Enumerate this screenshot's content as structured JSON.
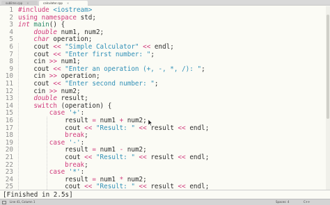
{
  "tabs": [
    {
      "label": "sublime.cpp",
      "active": false
    },
    {
      "label": "calculator.cpp",
      "active": true
    }
  ],
  "code_lines": [
    {
      "n": "1",
      "tokens": [
        {
          "t": "#include ",
          "c": "pp"
        },
        {
          "t": "<iostream>",
          "c": "str"
        }
      ]
    },
    {
      "n": "2",
      "tokens": [
        {
          "t": "using ",
          "c": "kw"
        },
        {
          "t": "namespace ",
          "c": "kw"
        },
        {
          "t": "std;",
          "c": "plain"
        }
      ]
    },
    {
      "n": "3",
      "tokens": [
        {
          "t": "int ",
          "c": "type"
        },
        {
          "t": "main",
          "c": "fn"
        },
        {
          "t": "() {",
          "c": "plain"
        }
      ]
    },
    {
      "n": "4",
      "tokens": [
        {
          "t": "    ",
          "c": "plain"
        },
        {
          "t": "double ",
          "c": "type"
        },
        {
          "t": "num1, num2;",
          "c": "plain"
        }
      ]
    },
    {
      "n": "5",
      "tokens": [
        {
          "t": "    ",
          "c": "plain"
        },
        {
          "t": "char ",
          "c": "type"
        },
        {
          "t": "operation;",
          "c": "plain"
        }
      ]
    },
    {
      "n": "6",
      "tokens": [
        {
          "t": "    cout ",
          "c": "plain"
        },
        {
          "t": "<< ",
          "c": "op"
        },
        {
          "t": "\"Simple Calculator\" ",
          "c": "str"
        },
        {
          "t": "<< ",
          "c": "op"
        },
        {
          "t": "endl;",
          "c": "plain"
        }
      ]
    },
    {
      "n": "7",
      "tokens": [
        {
          "t": "    cout ",
          "c": "plain"
        },
        {
          "t": "<< ",
          "c": "op"
        },
        {
          "t": "\"Enter first number: \"",
          "c": "str"
        },
        {
          "t": ";",
          "c": "plain"
        }
      ]
    },
    {
      "n": "8",
      "tokens": [
        {
          "t": "    cin ",
          "c": "plain"
        },
        {
          "t": ">> ",
          "c": "op"
        },
        {
          "t": "num1;",
          "c": "plain"
        }
      ]
    },
    {
      "n": "9",
      "tokens": [
        {
          "t": "    cout ",
          "c": "plain"
        },
        {
          "t": "<< ",
          "c": "op"
        },
        {
          "t": "\"Enter an operation (+, -, *, /): \"",
          "c": "str"
        },
        {
          "t": ";",
          "c": "plain"
        }
      ]
    },
    {
      "n": "10",
      "tokens": [
        {
          "t": "    cin ",
          "c": "plain"
        },
        {
          "t": ">> ",
          "c": "op"
        },
        {
          "t": "operation;",
          "c": "plain"
        }
      ]
    },
    {
      "n": "11",
      "tokens": [
        {
          "t": "    cout ",
          "c": "plain"
        },
        {
          "t": "<< ",
          "c": "op"
        },
        {
          "t": "\"Enter second number: \"",
          "c": "str"
        },
        {
          "t": ";",
          "c": "plain"
        }
      ]
    },
    {
      "n": "12",
      "tokens": [
        {
          "t": "    cin ",
          "c": "plain"
        },
        {
          "t": ">> ",
          "c": "op"
        },
        {
          "t": "num2;",
          "c": "plain"
        }
      ]
    },
    {
      "n": "13",
      "tokens": [
        {
          "t": "    ",
          "c": "plain"
        },
        {
          "t": "double ",
          "c": "type"
        },
        {
          "t": "result;",
          "c": "plain"
        }
      ]
    },
    {
      "n": "14",
      "tokens": [
        {
          "t": "    ",
          "c": "plain"
        },
        {
          "t": "switch ",
          "c": "kw"
        },
        {
          "t": "(operation) {",
          "c": "plain"
        }
      ]
    },
    {
      "n": "15",
      "tokens": [
        {
          "t": "        ",
          "c": "plain"
        },
        {
          "t": "case ",
          "c": "kw"
        },
        {
          "t": "'+'",
          "c": "str"
        },
        {
          "t": ":",
          "c": "plain"
        }
      ]
    },
    {
      "n": "16",
      "tokens": [
        {
          "t": "            result ",
          "c": "plain"
        },
        {
          "t": "= ",
          "c": "op"
        },
        {
          "t": "num1 ",
          "c": "plain"
        },
        {
          "t": "+ ",
          "c": "op"
        },
        {
          "t": "num2;",
          "c": "plain"
        }
      ]
    },
    {
      "n": "17",
      "tokens": [
        {
          "t": "            cout ",
          "c": "plain"
        },
        {
          "t": "<< ",
          "c": "op"
        },
        {
          "t": "\"Result: \" ",
          "c": "str"
        },
        {
          "t": "<< ",
          "c": "op"
        },
        {
          "t": "result ",
          "c": "plain"
        },
        {
          "t": "<< ",
          "c": "op"
        },
        {
          "t": "endl;",
          "c": "plain"
        }
      ]
    },
    {
      "n": "18",
      "tokens": [
        {
          "t": "            ",
          "c": "plain"
        },
        {
          "t": "break",
          "c": "kw"
        },
        {
          "t": ";",
          "c": "plain"
        }
      ]
    },
    {
      "n": "19",
      "tokens": [
        {
          "t": "        ",
          "c": "plain"
        },
        {
          "t": "case ",
          "c": "kw"
        },
        {
          "t": "'-'",
          "c": "str"
        },
        {
          "t": ":",
          "c": "plain"
        }
      ]
    },
    {
      "n": "20",
      "tokens": [
        {
          "t": "            result ",
          "c": "plain"
        },
        {
          "t": "= ",
          "c": "op"
        },
        {
          "t": "num1 ",
          "c": "plain"
        },
        {
          "t": "- ",
          "c": "op"
        },
        {
          "t": "num2;",
          "c": "plain"
        }
      ]
    },
    {
      "n": "21",
      "tokens": [
        {
          "t": "            cout ",
          "c": "plain"
        },
        {
          "t": "<< ",
          "c": "op"
        },
        {
          "t": "\"Result: \" ",
          "c": "str"
        },
        {
          "t": "<< ",
          "c": "op"
        },
        {
          "t": "result ",
          "c": "plain"
        },
        {
          "t": "<< ",
          "c": "op"
        },
        {
          "t": "endl;",
          "c": "plain"
        }
      ]
    },
    {
      "n": "22",
      "tokens": [
        {
          "t": "            ",
          "c": "plain"
        },
        {
          "t": "break",
          "c": "kw"
        },
        {
          "t": ";",
          "c": "plain"
        }
      ]
    },
    {
      "n": "23",
      "tokens": [
        {
          "t": "        ",
          "c": "plain"
        },
        {
          "t": "case ",
          "c": "kw"
        },
        {
          "t": "'*'",
          "c": "str"
        },
        {
          "t": ":",
          "c": "plain"
        }
      ]
    },
    {
      "n": "24",
      "tokens": [
        {
          "t": "            result ",
          "c": "plain"
        },
        {
          "t": "= ",
          "c": "op"
        },
        {
          "t": "num1 ",
          "c": "plain"
        },
        {
          "t": "* ",
          "c": "op"
        },
        {
          "t": "num2;",
          "c": "plain"
        }
      ]
    },
    {
      "n": "25",
      "tokens": [
        {
          "t": "            cout ",
          "c": "plain"
        },
        {
          "t": "<< ",
          "c": "op"
        },
        {
          "t": "\"Result: \" ",
          "c": "str"
        },
        {
          "t": "<< ",
          "c": "op"
        },
        {
          "t": "result ",
          "c": "plain"
        },
        {
          "t": "<< ",
          "c": "op"
        },
        {
          "t": "endl;",
          "c": "plain"
        }
      ]
    }
  ],
  "output_panel": {
    "text": "[Finished in 2.5s]"
  },
  "status_bar": {
    "position": "Line 41, Column 1",
    "indentation": "Spaces: 4",
    "syntax": "C++"
  },
  "icons": {
    "panel_toggle": "panel-icon",
    "tab_close": "close-icon",
    "mouse_cursor": "cursor-icon"
  }
}
